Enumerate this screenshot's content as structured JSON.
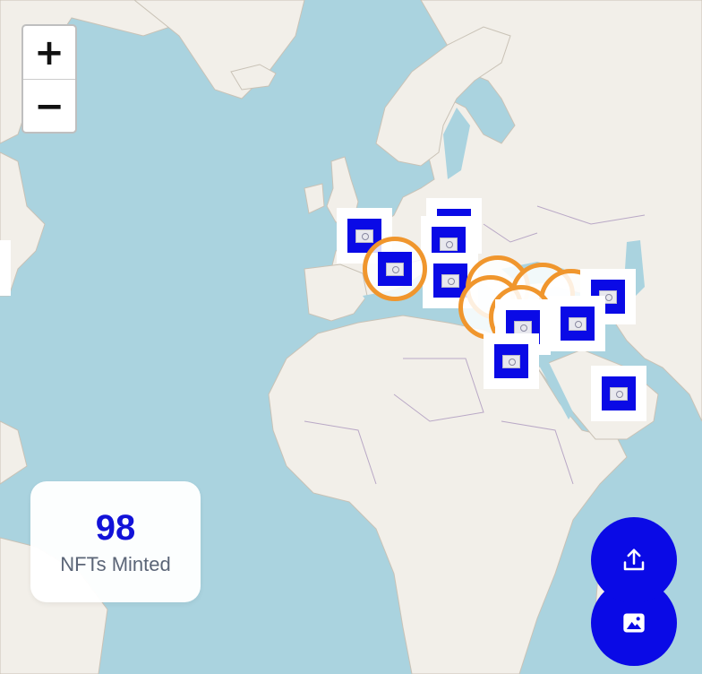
{
  "map": {
    "colors": {
      "water": "#aad3df",
      "land": "#f2efe9",
      "border": "#b9a8c6",
      "cluster_ring": "#f0962d",
      "marker": "#0a0ae6"
    },
    "zoom_in_label": "+",
    "zoom_out_label": "−"
  },
  "stats": {
    "count": "98",
    "label": "NFTs Minted"
  },
  "actions": {
    "upload_icon": "upload-icon",
    "gallery_icon": "image-icon"
  },
  "markers": [
    {
      "type": "single",
      "region": "france"
    },
    {
      "type": "single",
      "region": "central-europe"
    },
    {
      "type": "single",
      "region": "hungary"
    },
    {
      "type": "single",
      "region": "balkans"
    },
    {
      "type": "cluster",
      "region": "italy"
    },
    {
      "type": "cluster",
      "region": "aegean"
    },
    {
      "type": "single",
      "region": "georgia"
    },
    {
      "type": "single",
      "region": "syria"
    },
    {
      "type": "single",
      "region": "israel"
    },
    {
      "type": "single",
      "region": "egypt"
    },
    {
      "type": "single",
      "region": "arabia"
    }
  ]
}
